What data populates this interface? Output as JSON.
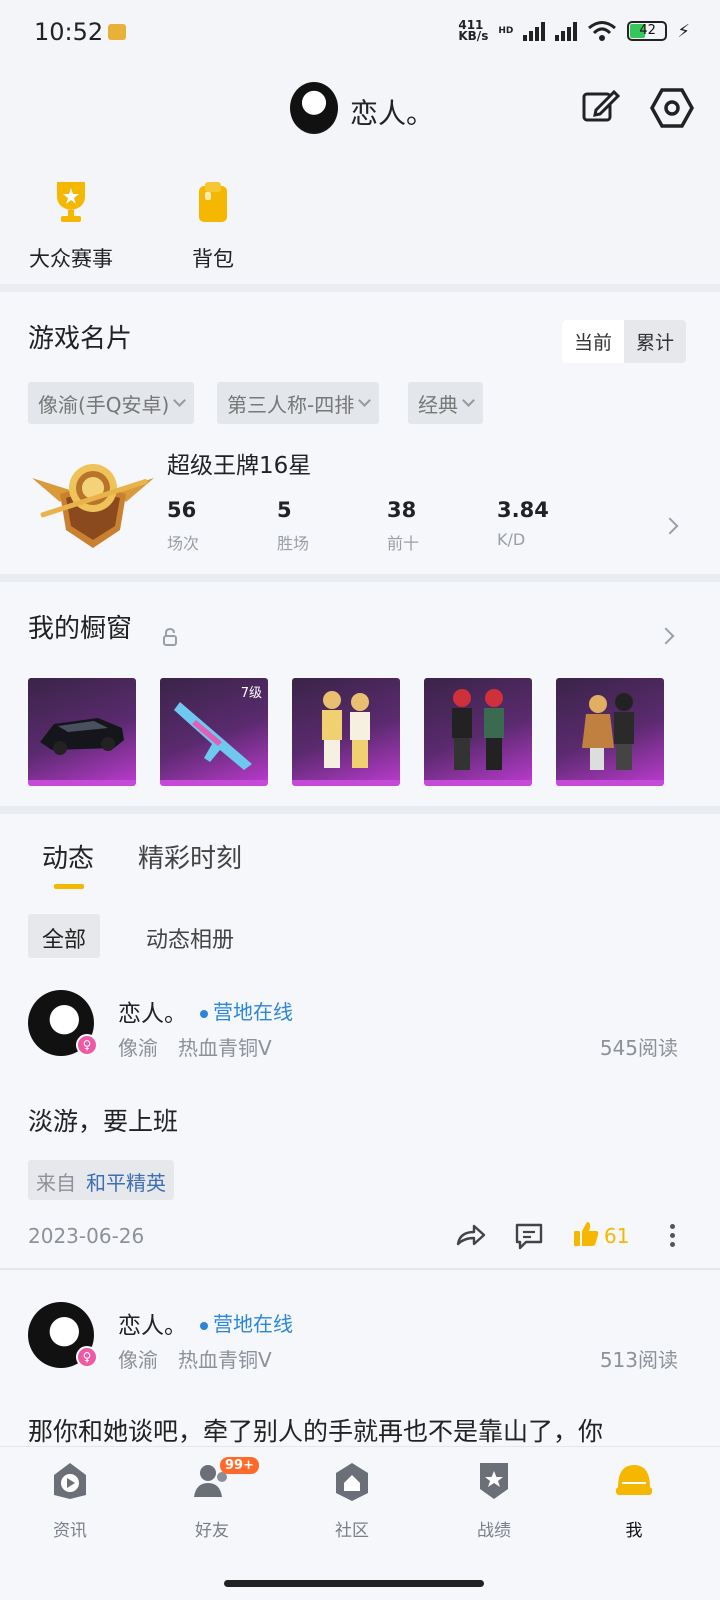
{
  "status_bar": {
    "time": "10:52",
    "net_speed_top": "411",
    "net_speed_unit": "KB/s",
    "hd": "HD",
    "battery": "42"
  },
  "header": {
    "nickname": "恋人。"
  },
  "quick_actions": [
    {
      "label": "大众赛事",
      "icon": "trophy-icon"
    },
    {
      "label": "背包",
      "icon": "backpack-icon"
    }
  ],
  "game_card": {
    "title": "游戏名片",
    "toggle": {
      "current": "当前",
      "cumulative": "累计"
    },
    "filters": [
      "像渝(手Q安卓)",
      "第三人称-四排",
      "经典"
    ],
    "rank": "超级王牌16星",
    "stats": [
      {
        "value": "56",
        "label": "场次"
      },
      {
        "value": "5",
        "label": "胜场"
      },
      {
        "value": "38",
        "label": "前十"
      },
      {
        "value": "3.84",
        "label": "K/D"
      }
    ]
  },
  "showcase": {
    "title": "我的橱窗",
    "items": [
      {
        "name": "car-item"
      },
      {
        "name": "rifle-skin-item",
        "tag": "7级"
      },
      {
        "name": "outfit-pair-item-1"
      },
      {
        "name": "outfit-pair-item-2"
      },
      {
        "name": "outfit-pair-item-3"
      }
    ]
  },
  "feed_tabs": {
    "active": "动态",
    "other": "精彩时刻",
    "sub_active": "全部",
    "sub_other": "动态相册"
  },
  "posts": [
    {
      "author": "恋人。",
      "status": "营地在线",
      "server": "像渝",
      "tier": "热血青铜V",
      "reads": "545阅读",
      "text": "淡游，要上班",
      "from_label": "来自",
      "from_game": "和平精英",
      "date": "2023-06-26",
      "likes": "61"
    },
    {
      "author": "恋人。",
      "status": "营地在线",
      "server": "像渝",
      "tier": "热血青铜V",
      "reads": "513阅读",
      "text": "那你和她谈吧，牵了别人的手就再也不是靠山了，你"
    }
  ],
  "nav": {
    "items": [
      {
        "label": "资讯"
      },
      {
        "label": "好友",
        "badge": "99+"
      },
      {
        "label": "社区"
      },
      {
        "label": "战绩"
      },
      {
        "label": "我"
      }
    ]
  },
  "colors": {
    "accent": "#f5b700",
    "link": "#2a86d8",
    "showcase_tile": "#b53ac8"
  }
}
